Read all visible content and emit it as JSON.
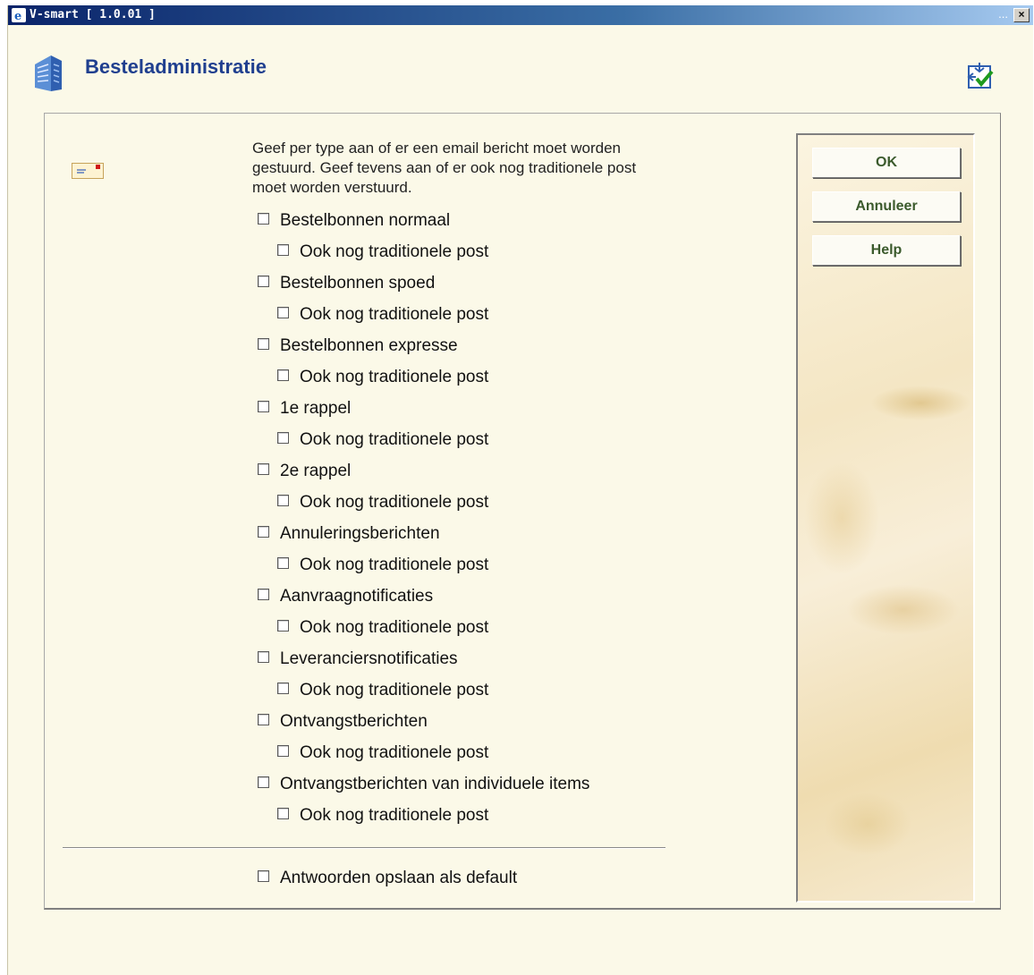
{
  "window": {
    "title": "V-smart [ 1.0.01 ]",
    "dots": "...",
    "close_glyph": "×"
  },
  "header": {
    "title": "Besteladministratie"
  },
  "instructions": "Geef per type aan of er een email bericht moet worden gestuurd. Geef tevens aan of er ook nog traditionele post moet worden verstuurd.",
  "options": [
    {
      "label": "Bestelbonnen normaal",
      "sub": "Ook nog traditionele post"
    },
    {
      "label": "Bestelbonnen spoed",
      "sub": "Ook nog traditionele post"
    },
    {
      "label": "Bestelbonnen expresse",
      "sub": "Ook nog traditionele post"
    },
    {
      "label": "1e rappel",
      "sub": "Ook nog traditionele post"
    },
    {
      "label": "2e rappel",
      "sub": "Ook nog traditionele post"
    },
    {
      "label": "Annuleringsberichten",
      "sub": "Ook nog traditionele post"
    },
    {
      "label": "Aanvraagnotificaties",
      "sub": "Ook nog traditionele post"
    },
    {
      "label": "Leveranciersnotificaties",
      "sub": "Ook nog traditionele post"
    },
    {
      "label": "Ontvangstberichten",
      "sub": "Ook nog traditionele post"
    },
    {
      "label": "Ontvangstberichten van individuele items",
      "sub": "Ook nog traditionele post"
    }
  ],
  "default_option": "Antwoorden opslaan als default",
  "buttons": {
    "ok": "OK",
    "cancel": "Annuleer",
    "help": "Help"
  },
  "icons": {
    "app": "library-building-icon",
    "mail": "envelope-icon",
    "tool": "settings-check-icon"
  }
}
